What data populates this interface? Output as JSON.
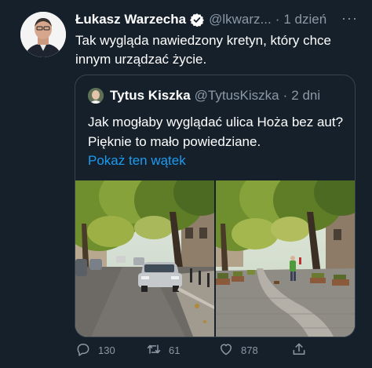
{
  "tweet": {
    "author_name": "Łukasz Warzecha",
    "handle": "@lkwarz...",
    "separator": "·",
    "time": "1 dzień",
    "more": "···",
    "text": "Tak wygląda nawiedzony kretyn, który chce innym urządzać życie."
  },
  "quoted_tweet": {
    "author_name": "Tytus Kiszka",
    "handle": "@TytusKiszka",
    "separator": "·",
    "time": "2 dni",
    "text": "Jak mogłaby wyglądać ulica Hoża bez aut? Pięknie to mało powiedziane.",
    "show_thread": "Pokaż ten wątek",
    "photos": [
      "street-with-cars",
      "street-without-cars"
    ]
  },
  "actions": {
    "replies": "130",
    "retweets": "61",
    "likes": "878"
  },
  "colors": {
    "background": "#15202b",
    "secondary_text": "#8b98a5",
    "link": "#1d9bf0",
    "border": "#38444d"
  }
}
